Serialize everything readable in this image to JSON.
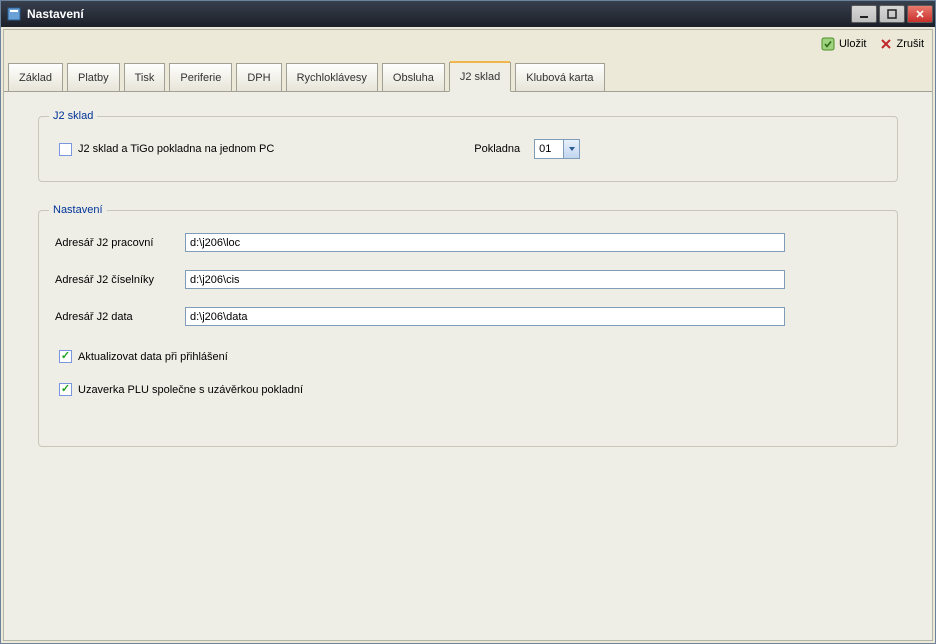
{
  "window": {
    "title": "Nastavení"
  },
  "toolbar": {
    "save_label": "Uložit",
    "cancel_label": "Zrušit"
  },
  "tabs": [
    {
      "label": "Základ"
    },
    {
      "label": "Platby"
    },
    {
      "label": "Tisk"
    },
    {
      "label": "Periferie"
    },
    {
      "label": "DPH"
    },
    {
      "label": "Rychloklávesy"
    },
    {
      "label": "Obsluha"
    },
    {
      "label": "J2 sklad"
    },
    {
      "label": "Klubová karta"
    }
  ],
  "active_tab_index": 7,
  "j2sklad": {
    "legend": "J2 sklad",
    "share_pc_label": "J2 sklad a TiGo pokladna na jednom PC",
    "share_pc_checked": false,
    "pokladna_label": "Pokladna",
    "pokladna_value": "01"
  },
  "nastaveni": {
    "legend": "Nastavení",
    "dir_work_label": "Adresář J2 pracovní",
    "dir_work_value": "d:\\j206\\loc",
    "dir_enum_label": "Adresář J2 číselníky",
    "dir_enum_value": "d:\\j206\\cis",
    "dir_data_label": "Adresář J2 data",
    "dir_data_value": "d:\\j206\\data",
    "update_on_login_label": "Aktualizovat data při přihlášení",
    "update_on_login_checked": true,
    "plu_close_label": "Uzaverka PLU společne s uzávěrkou pokladní",
    "plu_close_checked": true
  }
}
